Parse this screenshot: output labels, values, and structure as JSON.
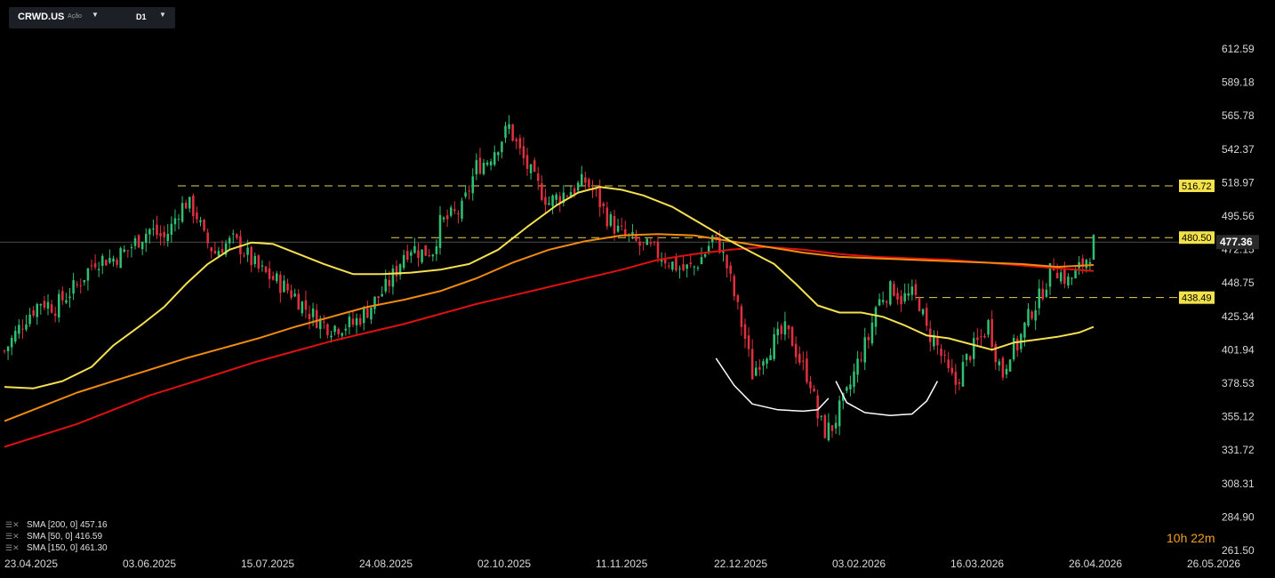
{
  "header": {
    "symbol": "CRWD.US",
    "symbol_type": "Ação",
    "timeframe": "D1"
  },
  "timer": "10h 22m",
  "legend": [
    {
      "label": "SMA [200, 0] 457.16",
      "color": "#e01010"
    },
    {
      "label": "SMA [50, 0] 416.59",
      "color": "#f5e050"
    },
    {
      "label": "SMA [150, 0] 461.30",
      "color": "#f08a10"
    }
  ],
  "chart_data": {
    "type": "candlestick",
    "y_ticks": [
      "612.59",
      "589.18",
      "565.78",
      "542.37",
      "518.97",
      "495.56",
      "472.15",
      "448.75",
      "425.34",
      "401.94",
      "378.53",
      "355.12",
      "331.72",
      "308.31",
      "284.90",
      "261.50"
    ],
    "x_ticks": [
      "23.04.2025",
      "03.06.2025",
      "15.07.2025",
      "24.08.2025",
      "02.10.2025",
      "11.11.2025",
      "22.12.2025",
      "03.02.2026",
      "16.03.2026",
      "26.04.2026",
      "26.05.2026"
    ],
    "ylim": [
      261.5,
      612.59
    ],
    "current_price": "477.36",
    "levels": [
      {
        "label": "516.72",
        "value": 516.72
      },
      {
        "label": "480.50",
        "value": 480.5
      },
      {
        "label": "438.49",
        "value": 438.49
      }
    ],
    "close_path": [
      [
        0,
        401
      ],
      [
        6,
        425
      ],
      [
        10,
        436
      ],
      [
        14,
        432
      ],
      [
        17,
        440
      ],
      [
        20,
        447
      ],
      [
        22,
        454
      ],
      [
        25,
        465
      ],
      [
        30,
        466
      ],
      [
        34,
        472
      ],
      [
        38,
        482
      ],
      [
        40,
        486
      ],
      [
        44,
        480
      ],
      [
        46,
        488
      ],
      [
        48,
        500
      ],
      [
        50,
        505
      ],
      [
        52,
        500
      ],
      [
        53,
        496
      ],
      [
        55,
        480
      ],
      [
        58,
        470
      ],
      [
        60,
        475
      ],
      [
        63,
        478
      ],
      [
        65,
        474
      ],
      [
        70,
        458
      ],
      [
        75,
        450
      ],
      [
        80,
        440
      ],
      [
        84,
        428
      ],
      [
        88,
        420
      ],
      [
        90,
        418
      ],
      [
        93,
        419
      ],
      [
        96,
        420
      ],
      [
        100,
        430
      ],
      [
        105,
        445
      ],
      [
        108,
        458
      ],
      [
        110,
        470
      ],
      [
        112,
        474
      ],
      [
        115,
        470
      ],
      [
        118,
        472
      ],
      [
        120,
        490
      ],
      [
        123,
        495
      ],
      [
        126,
        500
      ],
      [
        130,
        530
      ],
      [
        133,
        535
      ],
      [
        137,
        550
      ],
      [
        139,
        558
      ],
      [
        142,
        540
      ],
      [
        146,
        520
      ],
      [
        150,
        505
      ],
      [
        153,
        510
      ],
      [
        157,
        515
      ],
      [
        160,
        520
      ],
      [
        163,
        510
      ],
      [
        166,
        495
      ],
      [
        169,
        485
      ],
      [
        172,
        480
      ],
      [
        175,
        475
      ],
      [
        178,
        472
      ],
      [
        181,
        468
      ],
      [
        184,
        462
      ],
      [
        187,
        458
      ],
      [
        190,
        460
      ],
      [
        193,
        470
      ],
      [
        195,
        480
      ],
      [
        197,
        475
      ],
      [
        199,
        460
      ],
      [
        202,
        430
      ],
      [
        204,
        410
      ],
      [
        206,
        385
      ],
      [
        208,
        395
      ],
      [
        211,
        405
      ],
      [
        213,
        410
      ],
      [
        215,
        415
      ],
      [
        217,
        408
      ],
      [
        219,
        395
      ],
      [
        222,
        380
      ],
      [
        224,
        355
      ],
      [
        226,
        345
      ],
      [
        228,
        348
      ],
      [
        230,
        360
      ],
      [
        232,
        370
      ],
      [
        234,
        385
      ],
      [
        236,
        400
      ],
      [
        238,
        410
      ],
      [
        240,
        432
      ],
      [
        242,
        440
      ],
      [
        245,
        445
      ],
      [
        247,
        438
      ],
      [
        250,
        440
      ],
      [
        252,
        435
      ],
      [
        254,
        415
      ],
      [
        256,
        410
      ],
      [
        258,
        398
      ],
      [
        260,
        385
      ],
      [
        262,
        378
      ],
      [
        264,
        390
      ],
      [
        266,
        400
      ],
      [
        269,
        410
      ],
      [
        271,
        420
      ],
      [
        273,
        400
      ],
      [
        275,
        385
      ],
      [
        277,
        402
      ],
      [
        279,
        405
      ],
      [
        281,
        418
      ],
      [
        283,
        430
      ],
      [
        285,
        438
      ],
      [
        287,
        450
      ],
      [
        289,
        462
      ],
      [
        291,
        455
      ],
      [
        293,
        450
      ],
      [
        295,
        455
      ],
      [
        297,
        462
      ],
      [
        299,
        470
      ],
      [
        300,
        477.36
      ]
    ],
    "sma_50": [
      [
        0,
        376
      ],
      [
        8,
        375
      ],
      [
        16,
        380
      ],
      [
        24,
        390
      ],
      [
        30,
        405
      ],
      [
        38,
        420
      ],
      [
        44,
        432
      ],
      [
        50,
        448
      ],
      [
        56,
        462
      ],
      [
        62,
        472
      ],
      [
        68,
        477
      ],
      [
        74,
        476
      ],
      [
        80,
        470
      ],
      [
        88,
        462
      ],
      [
        96,
        455
      ],
      [
        104,
        455
      ],
      [
        112,
        456
      ],
      [
        120,
        458
      ],
      [
        128,
        462
      ],
      [
        136,
        472
      ],
      [
        144,
        488
      ],
      [
        152,
        503
      ],
      [
        158,
        512
      ],
      [
        164,
        516
      ],
      [
        170,
        514
      ],
      [
        176,
        510
      ],
      [
        184,
        502
      ],
      [
        192,
        490
      ],
      [
        200,
        478
      ],
      [
        206,
        470
      ],
      [
        212,
        462
      ],
      [
        218,
        448
      ],
      [
        224,
        433
      ],
      [
        230,
        428
      ],
      [
        236,
        428
      ],
      [
        242,
        425
      ],
      [
        248,
        419
      ],
      [
        254,
        412
      ],
      [
        260,
        410
      ],
      [
        266,
        406
      ],
      [
        272,
        402
      ],
      [
        278,
        407
      ],
      [
        284,
        409
      ],
      [
        290,
        411
      ],
      [
        296,
        414
      ],
      [
        300,
        418
      ]
    ],
    "sma_150": [
      [
        0,
        352
      ],
      [
        10,
        362
      ],
      [
        20,
        372
      ],
      [
        30,
        380
      ],
      [
        40,
        388
      ],
      [
        50,
        396
      ],
      [
        60,
        403
      ],
      [
        70,
        410
      ],
      [
        80,
        418
      ],
      [
        90,
        425
      ],
      [
        100,
        432
      ],
      [
        110,
        437
      ],
      [
        120,
        443
      ],
      [
        130,
        452
      ],
      [
        140,
        463
      ],
      [
        150,
        472
      ],
      [
        160,
        478
      ],
      [
        170,
        482
      ],
      [
        180,
        483
      ],
      [
        190,
        482
      ],
      [
        200,
        478
      ],
      [
        210,
        474
      ],
      [
        220,
        470
      ],
      [
        230,
        467
      ],
      [
        240,
        466
      ],
      [
        250,
        465
      ],
      [
        260,
        464
      ],
      [
        270,
        463
      ],
      [
        280,
        462
      ],
      [
        290,
        460
      ],
      [
        300,
        461.3
      ]
    ],
    "sma_200": [
      [
        0,
        334
      ],
      [
        10,
        342
      ],
      [
        20,
        350
      ],
      [
        30,
        360
      ],
      [
        40,
        370
      ],
      [
        50,
        378
      ],
      [
        60,
        386
      ],
      [
        70,
        394
      ],
      [
        80,
        401
      ],
      [
        90,
        408
      ],
      [
        100,
        414
      ],
      [
        110,
        420
      ],
      [
        120,
        427
      ],
      [
        130,
        434
      ],
      [
        140,
        440
      ],
      [
        150,
        446
      ],
      [
        160,
        452
      ],
      [
        170,
        458
      ],
      [
        180,
        465
      ],
      [
        190,
        469
      ],
      [
        200,
        472
      ],
      [
        210,
        474
      ],
      [
        220,
        472
      ],
      [
        230,
        469
      ],
      [
        240,
        467
      ],
      [
        250,
        466
      ],
      [
        260,
        465
      ],
      [
        270,
        463
      ],
      [
        280,
        461
      ],
      [
        290,
        459
      ],
      [
        300,
        457.16
      ]
    ],
    "pattern_arcs": [
      [
        [
          196,
          396
        ],
        [
          201,
          377
        ],
        [
          206,
          364
        ],
        [
          213,
          360
        ],
        [
          220,
          359
        ],
        [
          224,
          360
        ],
        [
          227,
          368
        ]
      ],
      [
        [
          229,
          380
        ],
        [
          232,
          365
        ],
        [
          237,
          358
        ],
        [
          244,
          356
        ],
        [
          250,
          357
        ],
        [
          254,
          366
        ],
        [
          257,
          380
        ]
      ]
    ]
  }
}
